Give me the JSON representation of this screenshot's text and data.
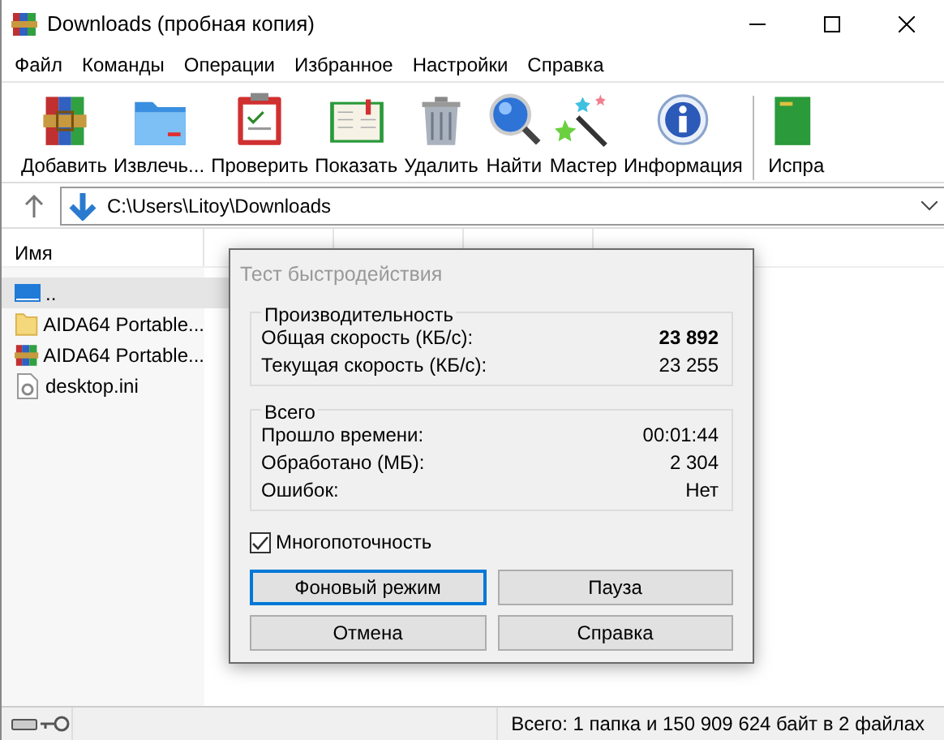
{
  "window": {
    "title": "Downloads (пробная копия)"
  },
  "menu": [
    "Файл",
    "Команды",
    "Операции",
    "Избранное",
    "Настройки",
    "Справка"
  ],
  "toolbar": [
    {
      "label": "Добавить",
      "kind": "archive"
    },
    {
      "label": "Извлечь...",
      "kind": "folder"
    },
    {
      "label": "Проверить",
      "kind": "clipboard"
    },
    {
      "label": "Показать",
      "kind": "book"
    },
    {
      "label": "Удалить",
      "kind": "trash"
    },
    {
      "label": "Найти",
      "kind": "magnifier"
    },
    {
      "label": "Мастер",
      "kind": "wand"
    },
    {
      "label": "Информация",
      "kind": "info"
    },
    {
      "label": "Испра",
      "kind": "repair"
    }
  ],
  "address": {
    "path": "C:\\Users\\Litoy\\Downloads"
  },
  "file_list": {
    "columns": [
      "Имя"
    ],
    "rows": [
      {
        "name": "..",
        "kind": "up",
        "selected": true
      },
      {
        "name": "AIDA64 Portable...",
        "kind": "folder",
        "selected": false
      },
      {
        "name": "AIDA64 Portable...",
        "kind": "archive",
        "selected": false
      },
      {
        "name": "desktop.ini",
        "kind": "file",
        "selected": false
      }
    ]
  },
  "dialog": {
    "title": "Тест быстродействия",
    "groups": [
      {
        "title": "Производительность",
        "rows": [
          {
            "label": "Общая скорость (КБ/с):",
            "value": "23 892",
            "bold": true
          },
          {
            "label": "Текущая скорость (КБ/с):",
            "value": "23 255",
            "bold": false
          }
        ]
      },
      {
        "title": "Всего",
        "rows": [
          {
            "label": "Прошло времени:",
            "value": "00:01:44",
            "bold": false
          },
          {
            "label": "Обработано (МБ):",
            "value": "2 304",
            "bold": false
          },
          {
            "label": "Ошибок:",
            "value": "Нет",
            "bold": false
          }
        ]
      }
    ],
    "multithreading": {
      "label": "Многопоточность",
      "checked": true
    },
    "buttons": [
      {
        "label": "Фоновый режим",
        "default": true
      },
      {
        "label": "Пауза",
        "default": false
      },
      {
        "label": "Отмена",
        "default": false
      },
      {
        "label": "Справка",
        "default": false
      }
    ]
  },
  "status_bar": {
    "text": "Всего: 1 папка и 150 909 624 байт в 2 файлах"
  }
}
